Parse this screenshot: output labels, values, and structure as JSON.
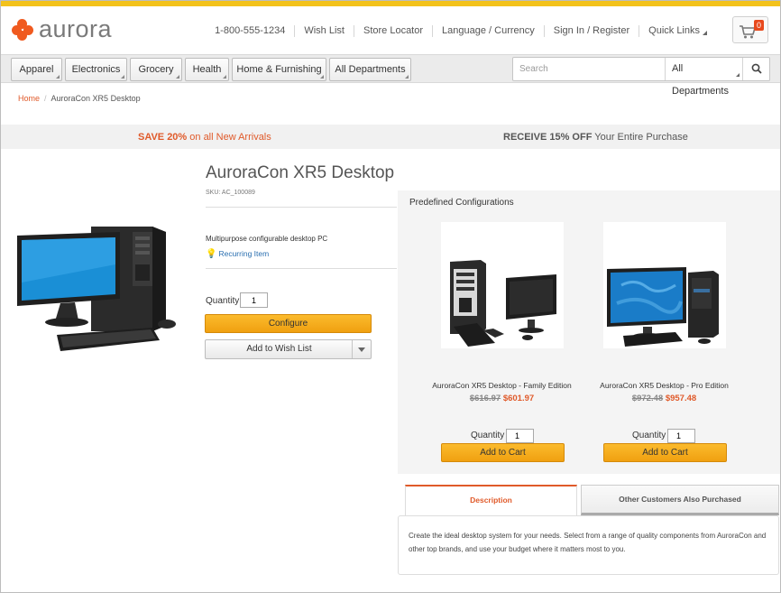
{
  "brand": {
    "name": "aurora",
    "accent": "#f05a1f",
    "stripe": "#f3c21b"
  },
  "util_nav": {
    "phone": "1-800-555-1234",
    "wish_list": "Wish List",
    "store_locator": "Store Locator",
    "language_currency": "Language / Currency",
    "sign_in": "Sign In / Register",
    "quick_links": "Quick Links",
    "cart_count": "0"
  },
  "categories": [
    "Apparel",
    "Electronics",
    "Grocery",
    "Health",
    "Home & Furnishing",
    "All Departments"
  ],
  "search": {
    "placeholder": "Search",
    "scope": "All Departments"
  },
  "breadcrumb": {
    "home": "Home",
    "current": "AuroraCon XR5 Desktop"
  },
  "promo": {
    "left_strong": "SAVE 20%",
    "left_rest": " on all New Arrivals",
    "right_strong": "RECEIVE 15% OFF",
    "right_rest": " Your Entire Purchase"
  },
  "product": {
    "title": "AuroraCon XR5 Desktop",
    "sku": "SKU: AC_100089",
    "description": "Multipurpose configurable desktop PC",
    "recurring": "Recurring Item",
    "qty_label": "Quantity",
    "qty_value": "1",
    "configure_label": "Configure",
    "wish_label": "Add to Wish List"
  },
  "configurations": {
    "title": "Predefined Configurations",
    "items": [
      {
        "name": "AuroraCon XR5 Desktop - Family Edition",
        "old_price": "$616.97",
        "new_price": "$601.97",
        "qty_label": "Quantity",
        "qty_value": "1",
        "button": "Add to Cart"
      },
      {
        "name": "AuroraCon XR5 Desktop - Pro Edition",
        "old_price": "$972.48",
        "new_price": "$957.48",
        "qty_label": "Quantity",
        "qty_value": "1",
        "button": "Add to Cart"
      }
    ]
  },
  "tabs": {
    "description": "Description",
    "others": "Other Customers Also Purchased",
    "content": "Create the ideal desktop system for your needs. Select from a range of quality components from AuroraCon and other top brands, and use your budget where it matters most to you."
  }
}
